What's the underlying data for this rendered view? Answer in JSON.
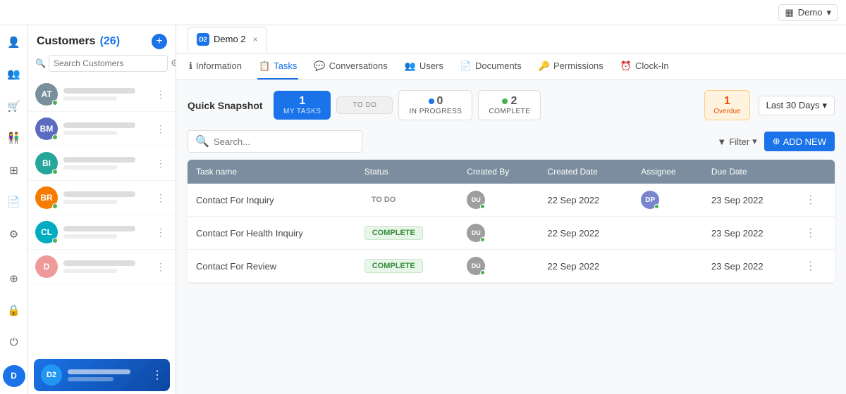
{
  "topbar": {
    "workspace_label": "Demo",
    "workspace_icon": "▦"
  },
  "sidebar": {
    "title": "Customers",
    "count": "(26)",
    "add_button_label": "+",
    "search_placeholder": "Search Customers",
    "items": [
      {
        "initials": "AT",
        "color": "#78909c",
        "has_dot": true
      },
      {
        "initials": "BM",
        "color": "#5c6bc0",
        "has_dot": true
      },
      {
        "initials": "BI",
        "color": "#26a69a",
        "has_dot": true
      },
      {
        "initials": "BR",
        "color": "#f57c00",
        "has_dot": true
      },
      {
        "initials": "CL",
        "color": "#00acc1",
        "has_dot": true
      },
      {
        "initials": "D",
        "color": "#ef9a9a",
        "has_dot": false
      },
      {
        "initials": "D2",
        "color": "#1a73e8",
        "has_dot": false,
        "active": true
      }
    ]
  },
  "tab": {
    "label": "Demo 2",
    "initials": "D2",
    "close_icon": "×"
  },
  "sub_nav": {
    "items": [
      {
        "key": "information",
        "label": "Information",
        "icon": "ℹ",
        "active": false
      },
      {
        "key": "tasks",
        "label": "Tasks",
        "icon": "📋",
        "active": true
      },
      {
        "key": "conversations",
        "label": "Conversations",
        "icon": "💬",
        "active": false
      },
      {
        "key": "users",
        "label": "Users",
        "icon": "👥",
        "active": false
      },
      {
        "key": "documents",
        "label": "Documents",
        "icon": "📄",
        "active": false
      },
      {
        "key": "permissions",
        "label": "Permissions",
        "icon": "🔑",
        "active": false
      },
      {
        "key": "clock_in",
        "label": "Clock-In",
        "icon": "⏰",
        "active": false
      }
    ]
  },
  "quick_snapshot": {
    "label": "Quick Snapshot",
    "cards": [
      {
        "key": "my_tasks",
        "number": "1",
        "label": "My Tasks",
        "type": "my-tasks"
      },
      {
        "key": "todo",
        "number": "",
        "label": "TO DO",
        "type": "todo",
        "has_dot": false
      },
      {
        "key": "in_progress",
        "number": "0",
        "label": "IN PROGRESS",
        "type": "in-progress",
        "has_dot": true,
        "dot_color": "blue"
      },
      {
        "key": "complete",
        "number": "2",
        "label": "COMPLETE",
        "type": "complete",
        "has_dot": true,
        "dot_color": "green"
      }
    ],
    "overdue": {
      "number": "1",
      "label": "Overdue"
    },
    "date_range": "Last 30 Days"
  },
  "task_list": {
    "search_placeholder": "Search...",
    "filter_label": "Filter",
    "add_new_label": "ADD NEW",
    "columns": [
      "Task name",
      "Status",
      "Created By",
      "Created Date",
      "Assignee",
      "Due Date"
    ],
    "rows": [
      {
        "name": "Contact For Inquiry",
        "status": "TO DO",
        "status_type": "todo",
        "created_by_initials": "DU",
        "created_by_color": "#9e9e9e",
        "created_date": "22 Sep 2022",
        "assignee_initials": "DP",
        "assignee_color": "#7986cb",
        "assignee_has_dot": true,
        "due_date": "23 Sep 2022"
      },
      {
        "name": "Contact For Health Inquiry",
        "status": "COMPLETE",
        "status_type": "complete",
        "created_by_initials": "DU",
        "created_by_color": "#9e9e9e",
        "created_date": "22 Sep 2022",
        "assignee_initials": "",
        "assignee_color": "",
        "assignee_has_dot": false,
        "due_date": "23 Sep 2022"
      },
      {
        "name": "Contact For Review",
        "status": "COMPLETE",
        "status_type": "complete",
        "created_by_initials": "DU",
        "created_by_color": "#9e9e9e",
        "created_date": "22 Sep 2022",
        "assignee_initials": "",
        "assignee_color": "",
        "assignee_has_dot": false,
        "due_date": "23 Sep 2022"
      }
    ]
  },
  "left_nav": {
    "icons": [
      {
        "key": "user-add",
        "symbol": "👤",
        "active": false
      },
      {
        "key": "group",
        "symbol": "👥",
        "active": false
      },
      {
        "key": "cart",
        "symbol": "🛒",
        "active": false
      },
      {
        "key": "users-settings",
        "symbol": "👫",
        "active": false
      },
      {
        "key": "modules",
        "symbol": "⊞",
        "active": false
      },
      {
        "key": "file",
        "symbol": "📄",
        "active": false
      },
      {
        "key": "settings",
        "symbol": "⚙",
        "active": false
      },
      {
        "key": "add-circle",
        "symbol": "+",
        "active": false
      },
      {
        "key": "lock",
        "symbol": "🔒",
        "active": false
      },
      {
        "key": "power",
        "symbol": "⏻",
        "active": false
      }
    ]
  }
}
